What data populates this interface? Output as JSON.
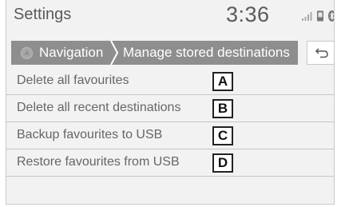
{
  "status_bar": {
    "title": "Settings",
    "time": "3:36",
    "icons": [
      "signal-icon",
      "phone-icon",
      "bluetooth-icon"
    ]
  },
  "breadcrumb": {
    "parent_label": "Navigation",
    "current_label": "Manage stored destinations",
    "icon": "navigation-icon"
  },
  "back_button": {
    "icon": "back-arrow-icon"
  },
  "menu_items": [
    {
      "label": "Delete all favourites",
      "callout": "A"
    },
    {
      "label": "Delete all recent destinations",
      "callout": "B"
    },
    {
      "label": "Backup favourites to USB",
      "callout": "C"
    },
    {
      "label": "Restore favourites from USB",
      "callout": "D"
    }
  ],
  "colors": {
    "breadcrumb_bg": "#8e8e8e",
    "screen_bg": "#f2f2f2",
    "text": "#666666"
  }
}
